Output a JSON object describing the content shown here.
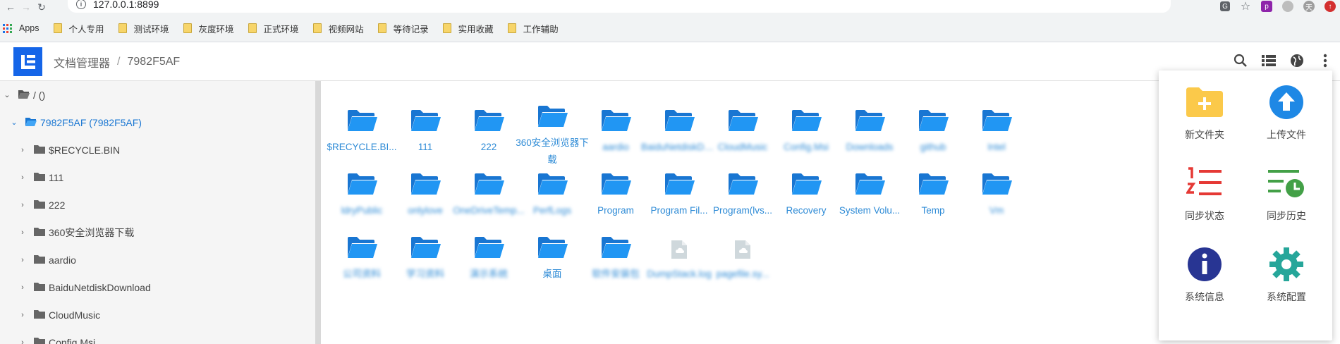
{
  "browser": {
    "url": "127.0.0.1:8899",
    "apps_label": "Apps",
    "bookmarks": [
      "个人专用",
      "测试环境",
      "灰度环境",
      "正式环境",
      "视频网站",
      "等待记录",
      "实用收藏",
      "工作辅助"
    ]
  },
  "header": {
    "title": "文档管理器",
    "separator": "/",
    "current": "7982F5AF"
  },
  "sidebar": {
    "root": "/ ()",
    "drive": "7982F5AF (7982F5AF)",
    "items": [
      "$RECYCLE.BIN",
      "111",
      "222",
      "360安全浏览器下载",
      "aardio",
      "BaiduNetdiskDownload",
      "CloudMusic",
      "Config.Msi"
    ]
  },
  "files": {
    "row1": [
      "$RECYCLE.BI...",
      "111",
      "222",
      "360安全浏览器下载",
      "aardio",
      "BaiduNetdiskDo...",
      "CloudMusic",
      "Config.Msi",
      "Downloads",
      "github",
      "Intel"
    ],
    "row2": [
      "ldryPublic",
      "onlylove",
      "OneDriveTemp...",
      "PerfLogs",
      "Program",
      "Program Fil...",
      "Program(lvs...",
      "Recovery",
      "System Volu...",
      "Temp",
      "Vm"
    ],
    "row3": [
      "公司资料",
      "学习资料",
      "演示系统",
      "桌面",
      "软件安装包",
      "DumpStack.log",
      "pagefile.sy..."
    ]
  },
  "menu": {
    "new_folder": "新文件夹",
    "upload": "上传文件",
    "sync_status": "同步状态",
    "sync_history": "同步历史",
    "sys_info": "系统信息",
    "sys_config": "系统配置"
  },
  "colors": {
    "accent": "#1565e8",
    "folder": "#2196f3",
    "link": "#2e8bd6"
  }
}
